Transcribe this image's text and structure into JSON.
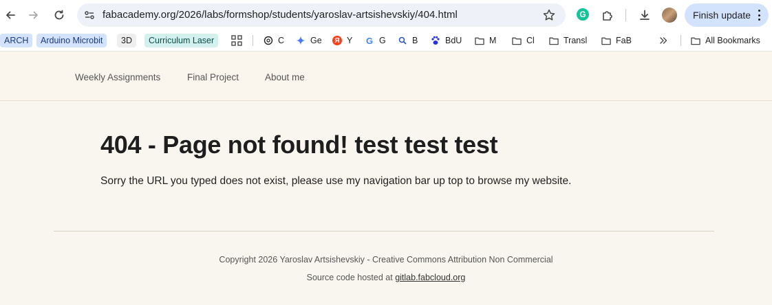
{
  "browser": {
    "url": "fabacademy.org/2026/labs/formshop/students/yaroslav-artsishevskiy/404.html",
    "finish_update_label": "Finish update",
    "grammarly_letter": "G",
    "bookmarks": [
      {
        "label": "ARCH",
        "icon": "",
        "color": "#d3e3fd"
      },
      {
        "label": "Arduino Microbit",
        "icon": "",
        "color": "#d3e3fd"
      },
      {
        "label": "3D",
        "icon": "",
        "color": "#eeeeee"
      },
      {
        "label": "Curriculum Laser",
        "icon": "",
        "color": "#d2f0ee"
      },
      {
        "label": "C",
        "icon": "openai-icon"
      },
      {
        "label": "Ge",
        "icon": "gemini-icon"
      },
      {
        "label": "Y",
        "icon": "yandex-icon"
      },
      {
        "label": "G",
        "icon": "google-icon"
      },
      {
        "label": "B",
        "icon": "search-icon"
      },
      {
        "label": "BdU",
        "icon": "baidu-icon"
      },
      {
        "label": "M",
        "icon": "folder-icon"
      },
      {
        "label": "Cl",
        "icon": "folder-icon"
      },
      {
        "label": "Transl",
        "icon": "folder-icon"
      },
      {
        "label": "FaB",
        "icon": "folder-icon"
      }
    ],
    "all_bookmarks_label": "All Bookmarks"
  },
  "nav": {
    "items": [
      "Weekly Assignments",
      "Final Project",
      "About me"
    ]
  },
  "content": {
    "title": "404 - Page not found! test test test",
    "text": "Sorry the URL you typed does not exist, please use my navigation bar up top to browse my website."
  },
  "footer": {
    "copyright": "Copyright 2026 Yaroslav Artsishevskiy - Creative Commons Attribution Non Commercial",
    "source_prefix": "Source code hosted at",
    "source_link": "gitlab.fabcloud.org"
  },
  "colors": {
    "page_background": "#f9f6ef",
    "omnibox": "#eef1f8",
    "finish_button": "#d3e3fd"
  }
}
